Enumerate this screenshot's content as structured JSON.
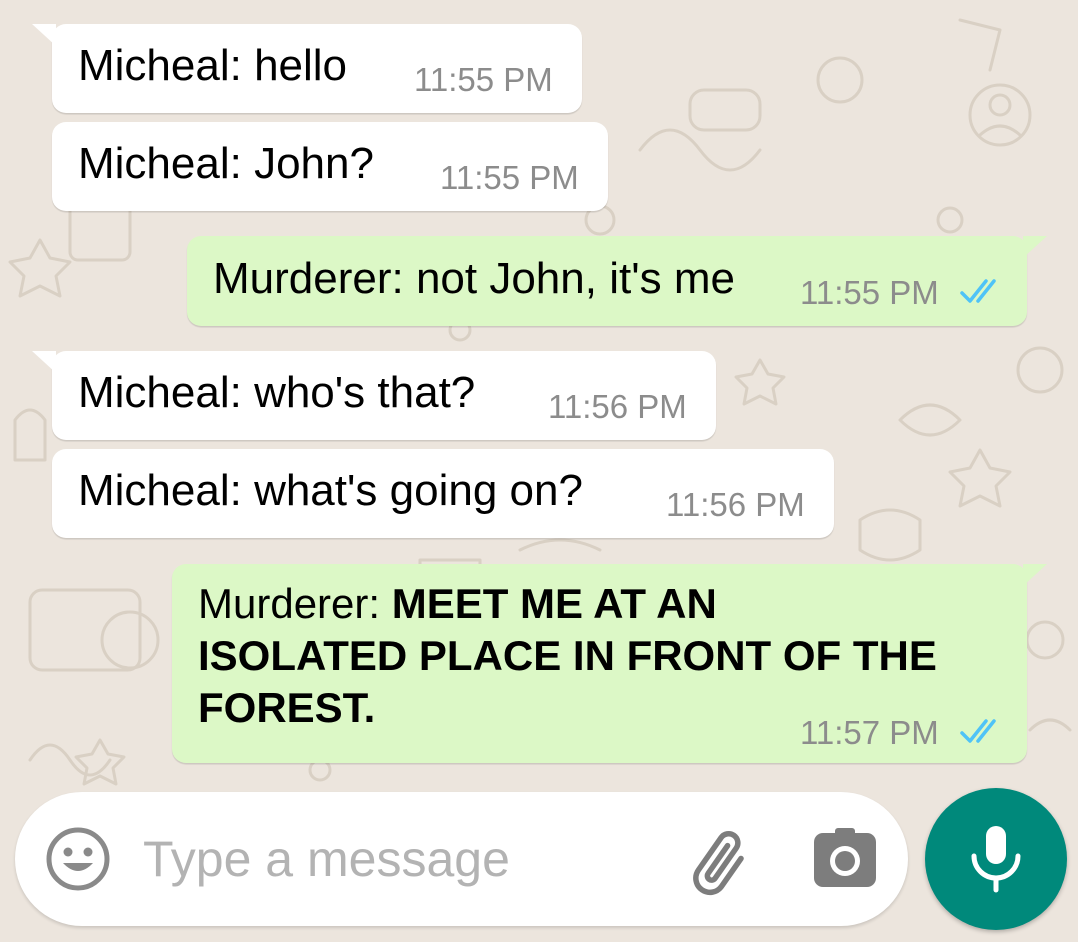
{
  "chat": {
    "messages": [
      {
        "sender": "Micheal",
        "text": "Micheal: hello",
        "time": "11:55 PM",
        "direction": "incoming"
      },
      {
        "sender": "Micheal",
        "text": "Micheal: John?",
        "time": "11:55 PM",
        "direction": "incoming"
      },
      {
        "sender": "Murderer",
        "text": "Murderer: not John, it's me",
        "time": "11:55 PM",
        "direction": "outgoing",
        "status": "read"
      },
      {
        "sender": "Micheal",
        "text": "Micheal: who's that?",
        "time": "11:56 PM",
        "direction": "incoming"
      },
      {
        "sender": "Micheal",
        "text": "Micheal: what's going on?",
        "time": "11:56 PM",
        "direction": "incoming"
      },
      {
        "sender": "Murderer",
        "prefix": "Murderer: ",
        "lines": [
          "MEET ME AT AN",
          "ISOLATED PLACE IN FRONT OF THE",
          "FOREST."
        ],
        "time": "11:57 PM",
        "direction": "outgoing",
        "status": "read"
      }
    ]
  },
  "composer": {
    "placeholder": "Type a message",
    "value": "",
    "icons": [
      "emoji-icon",
      "paperclip-icon",
      "camera-icon",
      "microphone-icon"
    ]
  },
  "colors": {
    "background": "#ece5dd",
    "incoming_bubble": "#ffffff",
    "outgoing_bubble": "#dcf8c6",
    "read_ticks": "#4fc3f7",
    "mic_button": "#00897b",
    "timestamp": "#8c8c8c"
  }
}
